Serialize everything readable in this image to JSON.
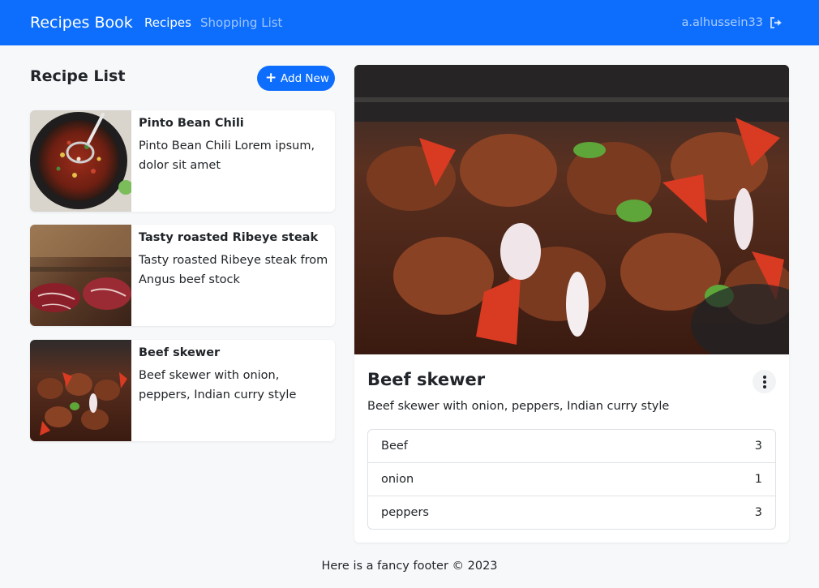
{
  "navbar": {
    "brand": "Recipes Book",
    "links": [
      "Recipes",
      "Shopping List"
    ],
    "user": "a.alhussein33",
    "logout_icon": "logout-icon",
    "color": "#0d6efd"
  },
  "list": {
    "title": "Recipe List",
    "add_label": "Add New",
    "add_icon": "plus-icon",
    "recipes": [
      {
        "name": "Pinto Bean Chili",
        "description": "Pinto Bean Chili Lorem ipsum, dolor sit amet"
      },
      {
        "name": "Tasty roasted Ribeye steak",
        "description": "Tasty roasted Ribeye steak from Angus beef stock"
      },
      {
        "name": "Beef skewer",
        "description": "Beef skewer with onion, peppers, Indian curry style"
      }
    ]
  },
  "detail": {
    "title": "Beef skewer",
    "description": "Beef skewer with onion, peppers, Indian curry style",
    "menu_icon": "kebab-menu-icon",
    "ingredients": [
      {
        "name": "Beef",
        "amount": "3"
      },
      {
        "name": "onion",
        "amount": "1"
      },
      {
        "name": "peppers",
        "amount": "3"
      }
    ]
  },
  "footer": "Here is a fancy footer © 2023"
}
